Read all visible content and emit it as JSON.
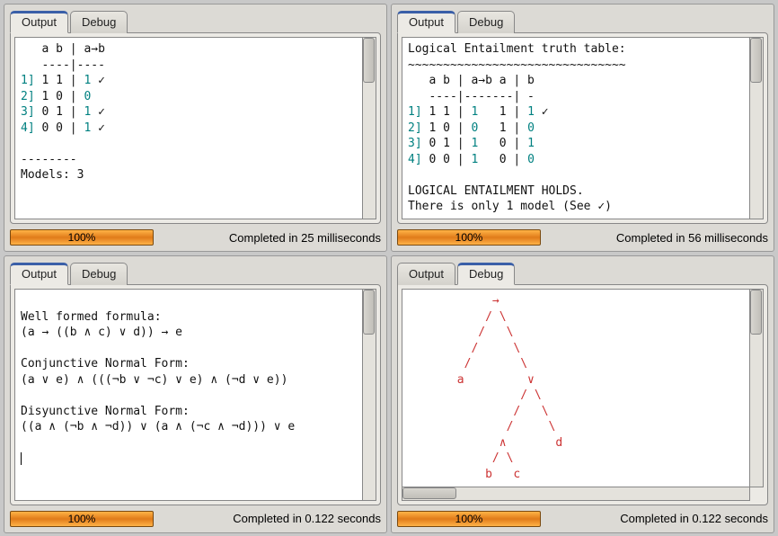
{
  "tabs": {
    "output": "Output",
    "debug": "Debug"
  },
  "panels": {
    "tl": {
      "activeTab": "output",
      "content_html": "   a b | a→b\n   ----|----\n<span class='teal'>1]</span> 1 1 | <span class='teal'>1</span> ✓\n<span class='teal'>2]</span> 1 0 | <span class='teal'>0</span>\n<span class='teal'>3]</span> 0 1 | <span class='teal'>1</span> ✓\n<span class='teal'>4]</span> 0 0 | <span class='teal'>1</span> ✓\n\n--------\nModels: 3",
      "progress": "100%",
      "status": "Completed in 25 milliseconds"
    },
    "tr": {
      "activeTab": "output",
      "content_html": "Logical Entailment truth table:\n~~~~~~~~~~~~~~~~~~~~~~~~~~~~~~~\n   a b | a→b a | b\n   ----|-------| -\n<span class='teal'>1]</span> 1 1 | <span class='teal'>1</span>   1 | <span class='teal'>1</span> ✓\n<span class='teal'>2]</span> 1 0 | <span class='teal'>0</span>   1 | <span class='teal'>0</span>\n<span class='teal'>3]</span> 0 1 | <span class='teal'>1</span>   0 | <span class='teal'>1</span>\n<span class='teal'>4]</span> 0 0 | <span class='teal'>1</span>   0 | <span class='teal'>0</span>\n\nLOGICAL ENTAILMENT HOLDS.\nThere is only 1 model (See ✓)",
      "progress": "100%",
      "status": "Completed in 56 milliseconds"
    },
    "bl": {
      "activeTab": "output",
      "content_html": "\nWell formed formula:\n(a → ((b ∧ c) ∨ d)) → e\n\nConjunctive Normal Form:\n(a ∨ e) ∧ (((¬b ∨ ¬c) ∨ e) ∧ (¬d ∨ e))\n\nDisyunctive Normal Form:\n((a ∧ (¬b ∧ ¬d)) ∨ (a ∧ (¬c ∧ ¬d))) ∨ e\n\n<span class='cursor'></span>",
      "progress": "100%",
      "status": "Completed in 0.122 seconds"
    },
    "br": {
      "activeTab": "debug",
      "content_html": "<span class='red'>            →\n           / \\\n          /   \\\n         /     \\\n        /       \\\n       a         ∨\n                / \\\n               /   \\\n              /     \\\n             ∧       d\n            / \\\n           b   c</span>",
      "progress": "100%",
      "status": "Completed in 0.122 seconds"
    }
  }
}
